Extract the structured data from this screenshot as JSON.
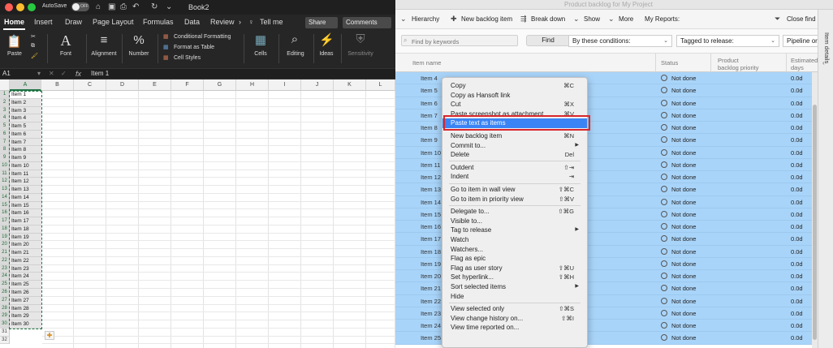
{
  "excel": {
    "autosave_label": "AutoSave",
    "autosave_state": "OFF",
    "doc_title": "Book2",
    "tabs": [
      "Home",
      "Insert",
      "Draw",
      "Page Layout",
      "Formulas",
      "Data",
      "Review"
    ],
    "tell_me": "Tell me",
    "share": "Share",
    "comments": "Comments",
    "ribbon": {
      "paste": "Paste",
      "font": "Font",
      "alignment": "Alignment",
      "number": "Number",
      "conditional_formatting": "Conditional Formatting",
      "format_as_table": "Format as Table",
      "cell_styles": "Cell Styles",
      "cells": "Cells",
      "editing": "Editing",
      "ideas": "Ideas",
      "sensitivity": "Sensitivity"
    },
    "name_box": "A1",
    "fx": "fx",
    "formula_value": "Item 1",
    "columns": [
      "A",
      "B",
      "C",
      "D",
      "E",
      "F",
      "G",
      "H",
      "I",
      "J",
      "K",
      "L"
    ],
    "rows": [
      "1",
      "2",
      "3",
      "4",
      "5",
      "6",
      "7",
      "8",
      "9",
      "10",
      "11",
      "12",
      "13",
      "14",
      "15",
      "16",
      "17",
      "18",
      "19",
      "20",
      "21",
      "22",
      "23",
      "24",
      "25",
      "26",
      "27",
      "28",
      "29",
      "30",
      "31",
      "32"
    ],
    "cells_a": [
      "Item 1",
      "Item 2",
      "Item 3",
      "Item 4",
      "Item 5",
      "Item 6",
      "Item 7",
      "Item 8",
      "Item 9",
      "Item 10",
      "Item 11",
      "Item 12",
      "Item 13",
      "Item 14",
      "Item 15",
      "Item 16",
      "Item 17",
      "Item 18",
      "Item 19",
      "Item 20",
      "Item 21",
      "Item 22",
      "Item 23",
      "Item 24",
      "Item 25",
      "Item 26",
      "Item 27",
      "Item 28",
      "Item 29",
      "Item 30"
    ]
  },
  "hansoft": {
    "window_title": "Product backlog for My Project",
    "toolbar": {
      "hierarchy": "Hierarchy",
      "new_backlog_item": "New backlog item",
      "break_down": "Break down",
      "show": "Show",
      "more": "More",
      "my_reports": "My Reports:",
      "close_find": "Close find"
    },
    "filter": {
      "search_placeholder": "Find by keywords",
      "find": "Find",
      "conditions": "By these conditions:",
      "tagged": "Tagged to release:",
      "pipeline": "Pipeline or"
    },
    "columns": {
      "item_name": "Item name",
      "status": "Status",
      "priority_1": "Product",
      "priority_2": "backlog priority",
      "estimate_1": "Estimated",
      "estimate_2": "days"
    },
    "rows": [
      {
        "name": "Item 4",
        "status": "Not done",
        "est": "0.0d"
      },
      {
        "name": "Item 5",
        "status": "Not done",
        "est": "0.0d"
      },
      {
        "name": "Item 6",
        "status": "Not done",
        "est": "0.0d"
      },
      {
        "name": "Item 7",
        "status": "Not done",
        "est": "0.0d"
      },
      {
        "name": "Item 8",
        "status": "Not done",
        "est": "0.0d"
      },
      {
        "name": "Item 9",
        "status": "Not done",
        "est": "0.0d"
      },
      {
        "name": "Item 10",
        "status": "Not done",
        "est": "0.0d"
      },
      {
        "name": "Item 11",
        "status": "Not done",
        "est": "0.0d"
      },
      {
        "name": "Item 12",
        "status": "Not done",
        "est": "0.0d"
      },
      {
        "name": "Item 13",
        "status": "Not done",
        "est": "0.0d"
      },
      {
        "name": "Item 14",
        "status": "Not done",
        "est": "0.0d"
      },
      {
        "name": "Item 15",
        "status": "Not done",
        "est": "0.0d"
      },
      {
        "name": "Item 16",
        "status": "Not done",
        "est": "0.0d"
      },
      {
        "name": "Item 17",
        "status": "Not done",
        "est": "0.0d"
      },
      {
        "name": "Item 18",
        "status": "Not done",
        "est": "0.0d"
      },
      {
        "name": "Item 19",
        "status": "Not done",
        "est": "0.0d"
      },
      {
        "name": "Item 20",
        "status": "Not done",
        "est": "0.0d"
      },
      {
        "name": "Item 21",
        "status": "Not done",
        "est": "0.0d"
      },
      {
        "name": "Item 22",
        "status": "Not done",
        "est": "0.0d"
      },
      {
        "name": "Item 23",
        "status": "Not done",
        "est": "0.0d"
      },
      {
        "name": "Item 24",
        "status": "Not done",
        "est": "0.0d"
      },
      {
        "name": "Item 25",
        "status": "Not done",
        "est": "0.0d"
      }
    ],
    "side_label": "Item details"
  },
  "context_menu": [
    {
      "label": "Copy",
      "shortcut": "⌘C"
    },
    {
      "label": "Copy as Hansoft link",
      "shortcut": ""
    },
    {
      "label": "Cut",
      "shortcut": "⌘X"
    },
    {
      "label": "Paste screenshot as attachment",
      "shortcut": "⌘V"
    },
    {
      "label": "Paste text as items",
      "shortcut": "",
      "highlighted": true
    },
    {
      "sep": true
    },
    {
      "label": "New backlog item",
      "shortcut": "⌘N"
    },
    {
      "label": "Commit to...",
      "shortcut": "",
      "submenu": true
    },
    {
      "label": "Delete",
      "shortcut": "Del"
    },
    {
      "sep": true
    },
    {
      "label": "Outdent",
      "shortcut": "⇧⇥"
    },
    {
      "label": "Indent",
      "shortcut": "⇥"
    },
    {
      "sep": true
    },
    {
      "label": "Go to item in wall view",
      "shortcut": "⇧⌘C"
    },
    {
      "label": "Go to item in priority view",
      "shortcut": "⇧⌘V"
    },
    {
      "sep": true
    },
    {
      "label": "Delegate to...",
      "shortcut": "⇧⌘G"
    },
    {
      "label": "Visible to...",
      "shortcut": ""
    },
    {
      "label": "Tag to release",
      "shortcut": "",
      "submenu": true
    },
    {
      "label": "Watch",
      "shortcut": ""
    },
    {
      "label": "Watchers...",
      "shortcut": ""
    },
    {
      "label": "Flag as epic",
      "shortcut": ""
    },
    {
      "label": "Flag as user story",
      "shortcut": "⇧⌘U"
    },
    {
      "label": "Set hyperlink...",
      "shortcut": "⇧⌘H"
    },
    {
      "label": "Sort selected items",
      "shortcut": "",
      "submenu": true
    },
    {
      "label": "Hide",
      "shortcut": ""
    },
    {
      "sep": true
    },
    {
      "label": "View selected only",
      "shortcut": "⇧⌘S"
    },
    {
      "label": "View change history on...",
      "shortcut": "⇧⌘I"
    },
    {
      "label": "View time reported on...",
      "shortcut": ""
    }
  ],
  "colors": {
    "excel_green": "#217346",
    "selection_blue": "#a9d4f9",
    "menu_highlight": "#3b84f5",
    "callout_red": "#d9262d"
  }
}
